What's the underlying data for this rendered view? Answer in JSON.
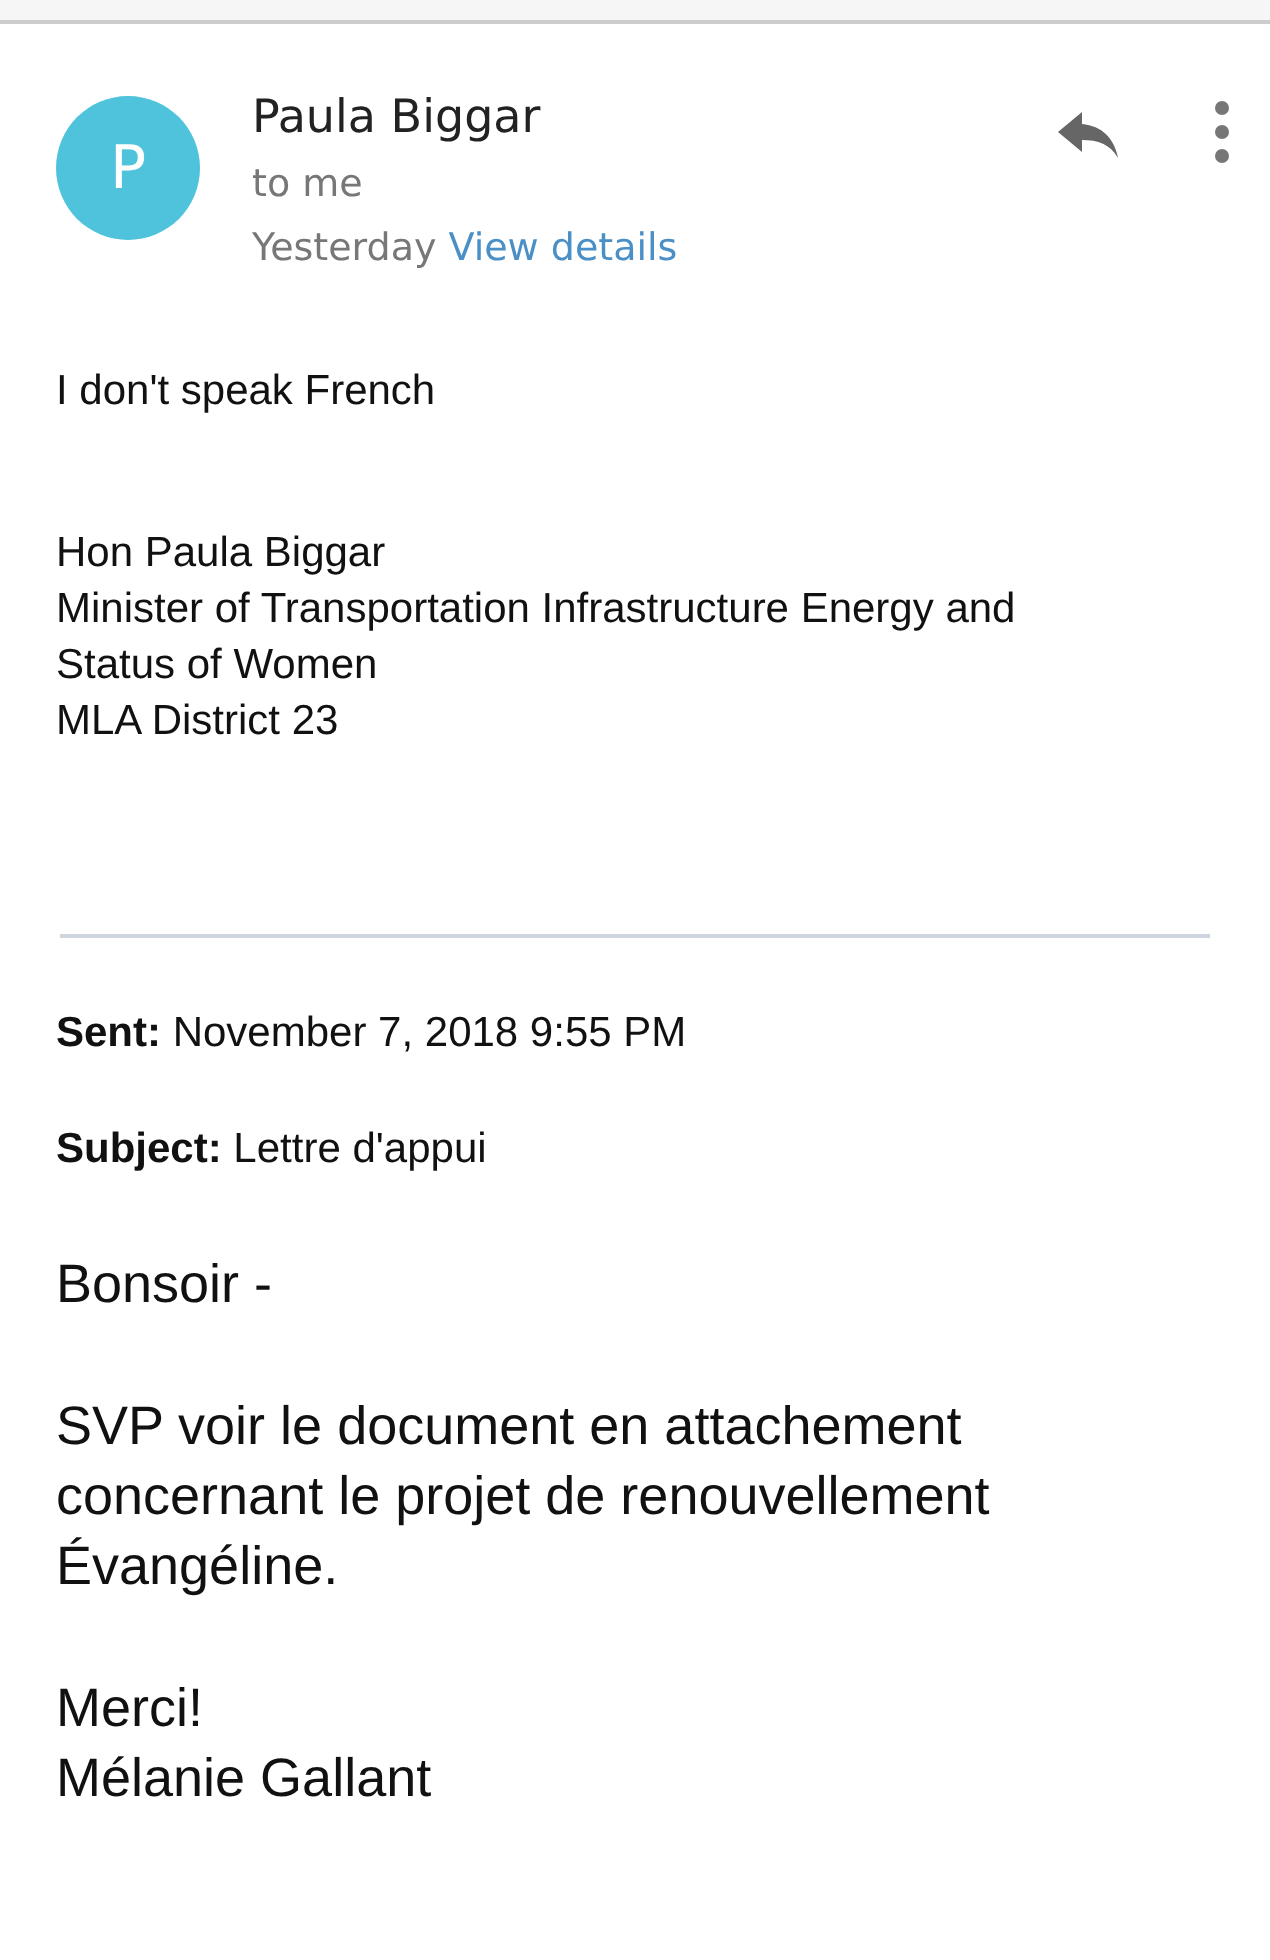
{
  "sender": {
    "initial": "P",
    "name": "Paula Biggar",
    "recipient": "to me",
    "date": "Yesterday",
    "details_link": "View details"
  },
  "message": {
    "opening": "I don't speak French",
    "signature": [
      "Hon Paula Biggar",
      "Minister of Transportation Infrastructure Energy and",
      "Status of Women",
      "MLA District 23"
    ],
    "quoted_header": [
      "**Sent:** November 7, 2018 9:55 PM",
      "**Subject:** Lettre d'appui"
    ],
    "quoted_body": [
      [
        "Bonsoir -"
      ],
      [
        "SVP voir le document en attachement",
        "concernant le projet de renouvellement",
        "Évangéline."
      ],
      [
        "Merci!",
        "Mélanie Gallant"
      ]
    ]
  }
}
